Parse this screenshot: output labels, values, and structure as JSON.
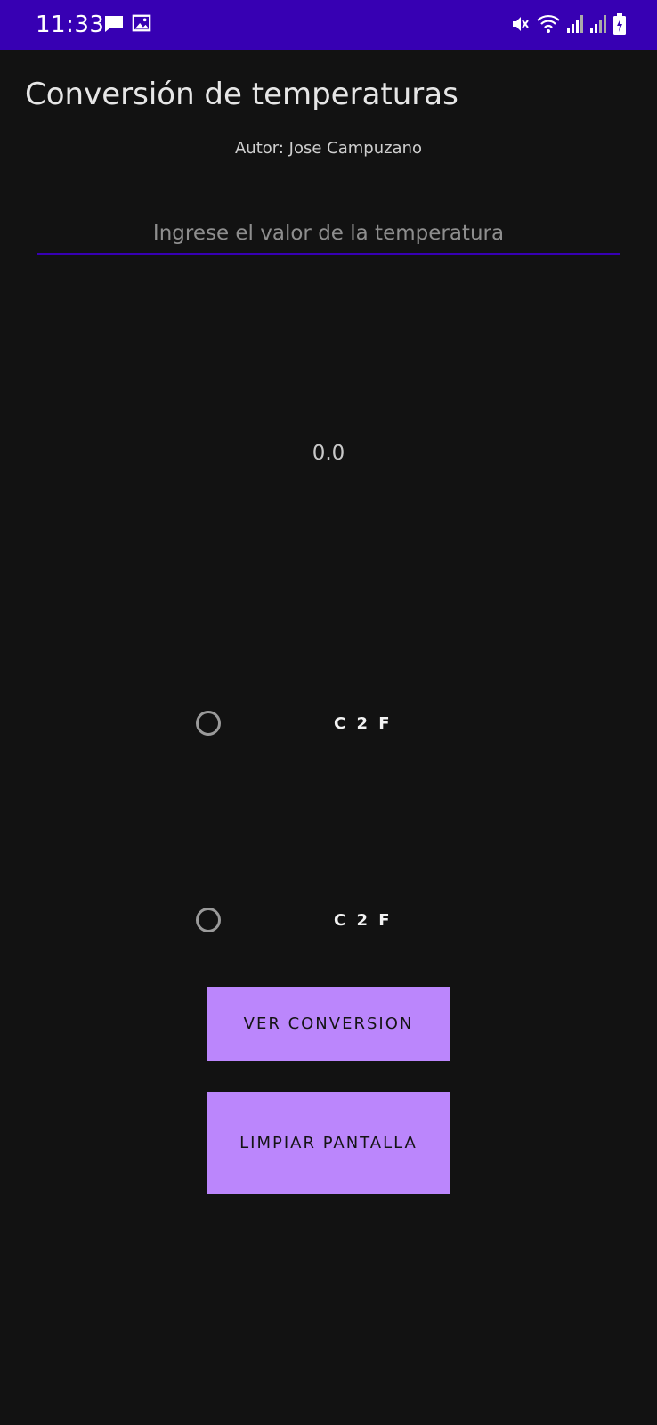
{
  "status_bar": {
    "time": "11:33",
    "icons": [
      "message-icon",
      "image-icon",
      "mute-icon",
      "wifi-icon",
      "signal-icon",
      "signal-icon",
      "battery-icon"
    ],
    "background": "#3700b3"
  },
  "app": {
    "title": "Conversión de temperaturas",
    "author": "Autor: Jose Campuzano"
  },
  "input": {
    "value": "",
    "placeholder": "Ingrese el valor de la temperatura"
  },
  "result": {
    "value": "0.0"
  },
  "radios": [
    {
      "label": "C 2 F",
      "checked": false
    },
    {
      "label": "C 2 F",
      "checked": false
    }
  ],
  "buttons": {
    "convert_label": "VER CONVERSION",
    "clear_label": "LIMPIAR PANTALLA"
  },
  "colors": {
    "background": "#121212",
    "primary_dark": "#3700b3",
    "button": "#bb86fc"
  }
}
